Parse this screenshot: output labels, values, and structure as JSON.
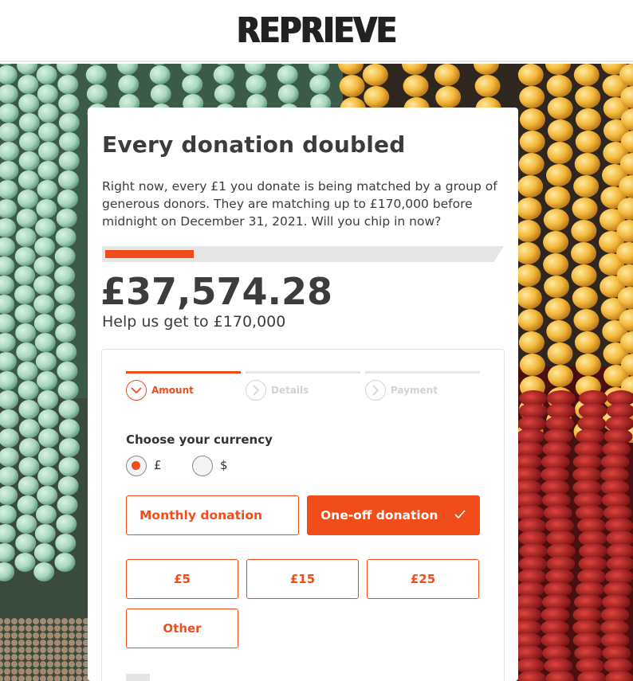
{
  "header": {
    "logo_text": "REPRIEVE"
  },
  "campaign": {
    "title": "Every donation doubled",
    "intro": "Right now, every £1 you donate is being matched by a group of generous donors. They are matching up to £170,000 before midnight on December 31, 2021. Will you chip in now?",
    "raised": "£37,574.28",
    "goal_text": "Help us get to £170,000",
    "progress_fraction": 0.221
  },
  "steps": [
    {
      "label": "Amount",
      "active": true
    },
    {
      "label": "Details",
      "active": false
    },
    {
      "label": "Payment",
      "active": false
    }
  ],
  "currency": {
    "label": "Choose your currency",
    "options": [
      {
        "symbol": "£",
        "selected": true
      },
      {
        "symbol": "$",
        "selected": false
      }
    ]
  },
  "frequency": {
    "monthly_label": "Monthly donation",
    "oneoff_label": "One-off donation",
    "selected": "one-off"
  },
  "amounts": [
    "£5",
    "£15",
    "£25",
    "Other"
  ],
  "colors": {
    "accent": "#f04d1b",
    "text": "#3c3c3c",
    "border": "#e3e3e3"
  }
}
